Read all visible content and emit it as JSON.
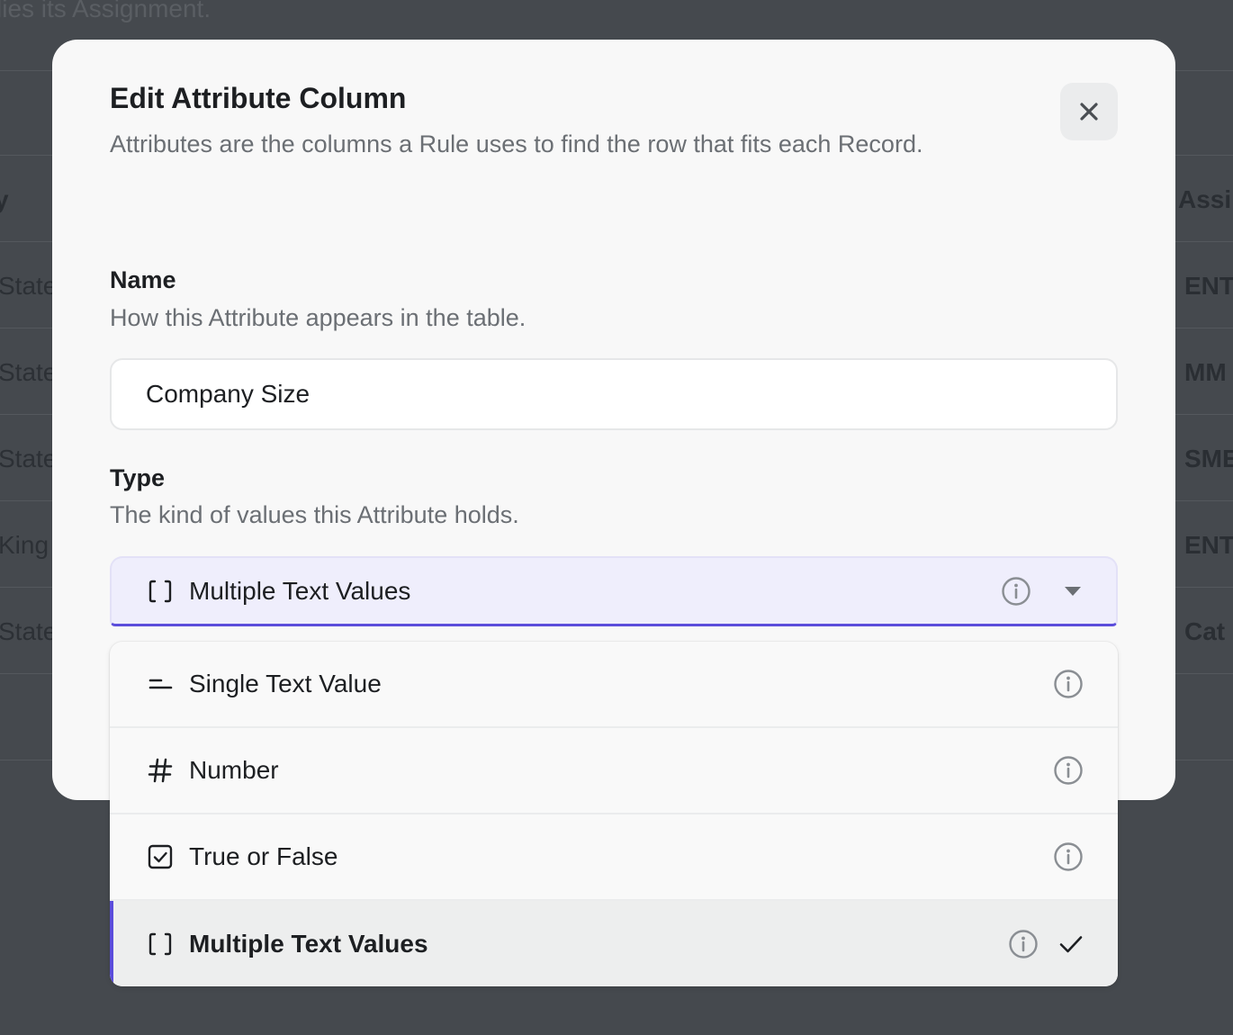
{
  "background": {
    "top_text": "lies its Assignment.",
    "header_left": "y",
    "header_right": "Assi",
    "rows": [
      {
        "left": "State",
        "right": "ENT"
      },
      {
        "left": "State",
        "right": "MM"
      },
      {
        "left": "State",
        "right": "SME"
      },
      {
        "left": "King",
        "right": "ENT"
      },
      {
        "left": "State",
        "right": "Cat"
      }
    ]
  },
  "modal": {
    "title": "Edit Attribute Column",
    "description": "Attributes are the columns a Rule uses to find the row that fits each Record.",
    "close_icon": "close-icon",
    "name_field": {
      "label": "Name",
      "hint": "How this Attribute appears in the table.",
      "value": "Company Size"
    },
    "type_field": {
      "label": "Type",
      "hint": "The kind of values this Attribute holds.",
      "selected_label": "Multiple Text Values",
      "selected_icon": "brackets-icon"
    }
  },
  "dropdown": {
    "options": [
      {
        "label": "Single Text Value",
        "icon": "equals-icon",
        "selected": false
      },
      {
        "label": "Number",
        "icon": "hash-icon",
        "selected": false
      },
      {
        "label": "True or False",
        "icon": "checkbox-icon",
        "selected": false
      },
      {
        "label": "Multiple Text Values",
        "icon": "brackets-icon",
        "selected": true
      }
    ]
  },
  "colors": {
    "accent": "#5b4ddb",
    "overlay": "#45494e",
    "modal_bg": "#f8f8f8",
    "select_bg": "#efeefc"
  }
}
